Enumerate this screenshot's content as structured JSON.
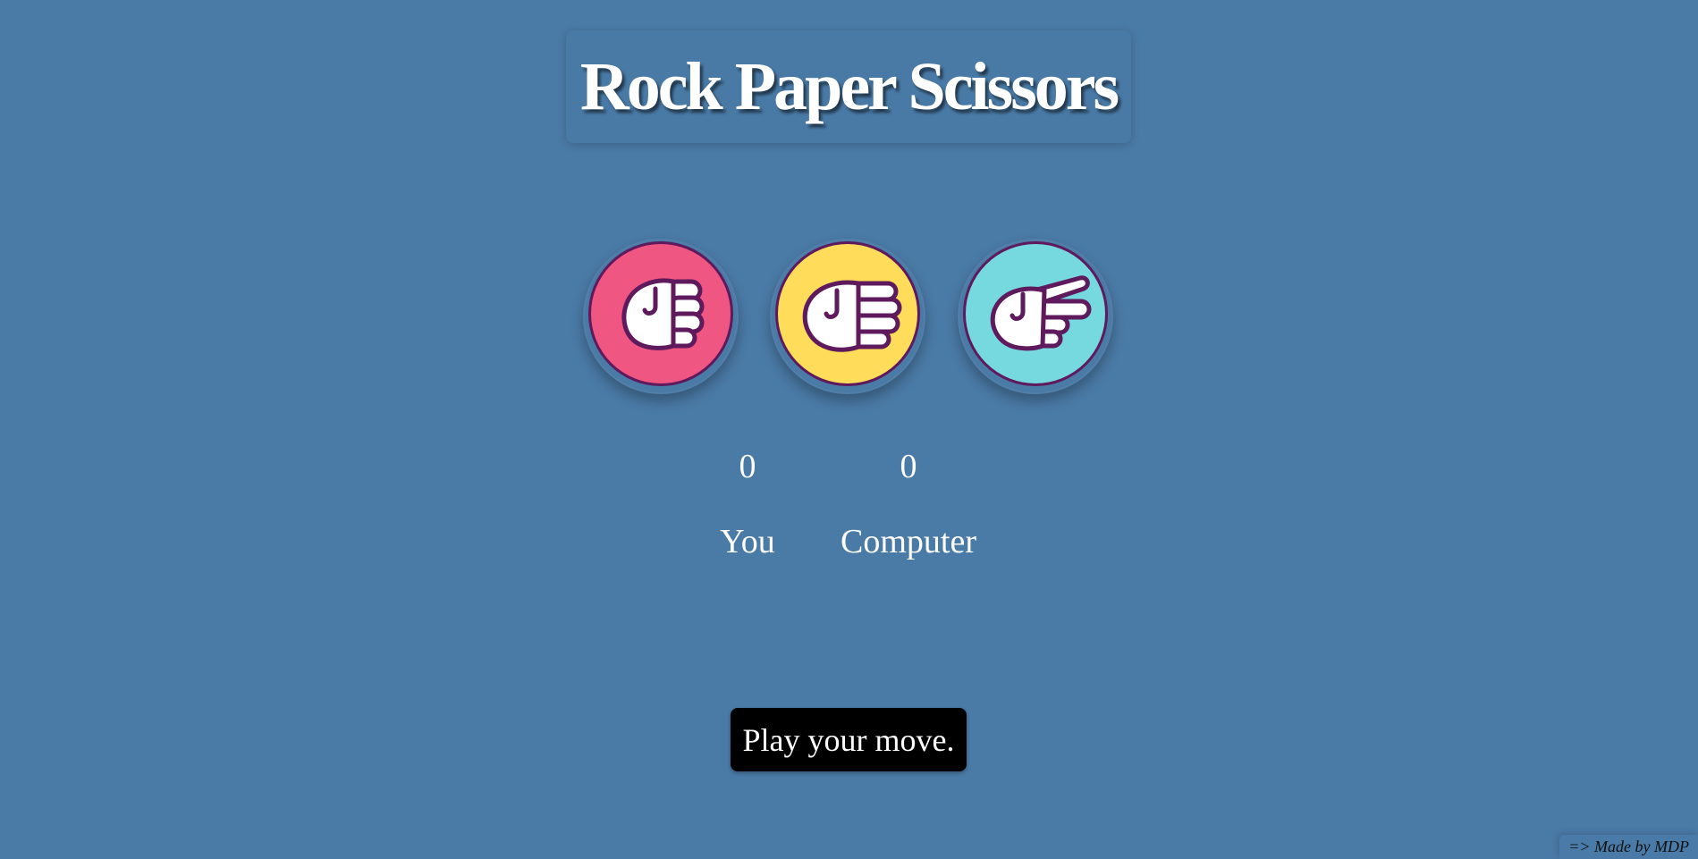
{
  "title": "Rock Paper Scissors",
  "choices": [
    {
      "name": "rock",
      "icon": "fist-icon",
      "color": "#ef5682"
    },
    {
      "name": "paper",
      "icon": "open-hand-icon",
      "color": "#ffdc5a"
    },
    {
      "name": "scissors",
      "icon": "scissors-hand-icon",
      "color": "#76d9df"
    }
  ],
  "scoreboard": {
    "you_score": "0",
    "computer_score": "0",
    "you_label": "You",
    "computer_label": "Computer"
  },
  "message": "Play your move.",
  "credit": "=> Made by MDP",
  "colors": {
    "background": "#4a7aa6",
    "outline": "#5e1a5c",
    "message_bg": "#000000"
  }
}
